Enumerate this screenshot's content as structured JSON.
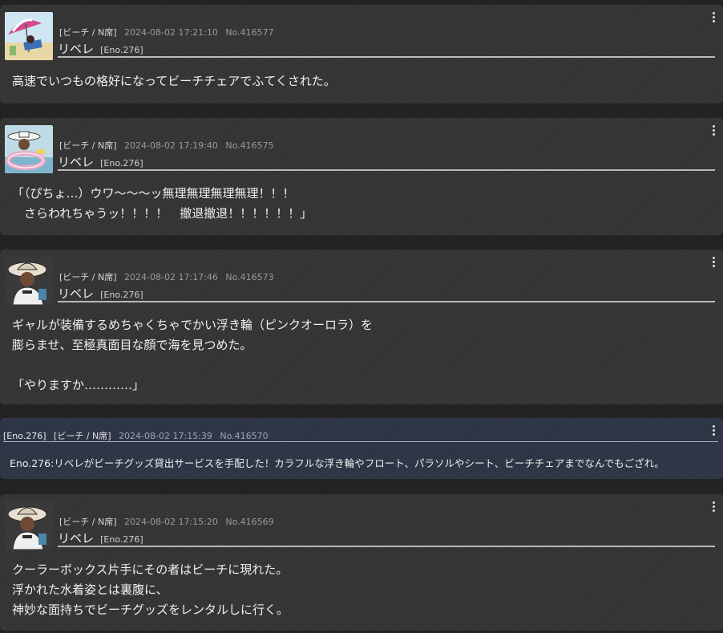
{
  "posts": [
    {
      "place": "[ビーチ / N席]",
      "date": "2024-08-02 17:21:10",
      "number": "No.416577",
      "name": "リベレ",
      "eno": "[Eno.276]",
      "avatar": "beach-umbrella-avatar",
      "text": "高速でいつもの格好になってビーチチェアでふてくされた。"
    },
    {
      "place": "[ビーチ / N席]",
      "date": "2024-08-02 17:19:40",
      "number": "No.416575",
      "name": "リベレ",
      "eno": "[Eno.276]",
      "avatar": "swim-ring-avatar",
      "text": "「（ぴちょ…）ウワ〜〜〜ッ無理無理無理無理！！！\n　さらわれちゃうッ！！！！　撤退撤退！！！！！！」"
    },
    {
      "place": "[ビーチ / N席]",
      "date": "2024-08-02 17:17:46",
      "number": "No.416573",
      "name": "リベレ",
      "eno": "[Eno.276]",
      "avatar": "hat-character-avatar",
      "text": "ギャルが装備するめちゃくちゃでかい浮き輪（ピンクオーロラ）を\n膨らませ、至極真面目な顔で海を見つめた。\n\n「やりますか…………」"
    },
    {
      "place": "[ビーチ / N席]",
      "date": "2024-08-02 17:15:20",
      "number": "No.416569",
      "name": "リベレ",
      "eno": "[Eno.276]",
      "avatar": "hat-character-avatar",
      "text": "クーラーボックス片手にその者はビーチに現れた。\n浮かれた水着姿とは裏腹に、\n神妙な面持ちでビーチグッズをレンタルしに行く。"
    }
  ],
  "system_post": {
    "eno": "[Eno.276]",
    "place": "[ビーチ / N席]",
    "date": "2024-08-02 17:15:39",
    "number": "No.416570",
    "text": "Eno.276:リベレがビーチグッズ貸出サービスを手配した！カラフルな浮き輪やフロート、パラソルやシート、ビーチチェアまでなんでもござれ。"
  },
  "icons": {
    "menu": "more-vertical-icon"
  }
}
